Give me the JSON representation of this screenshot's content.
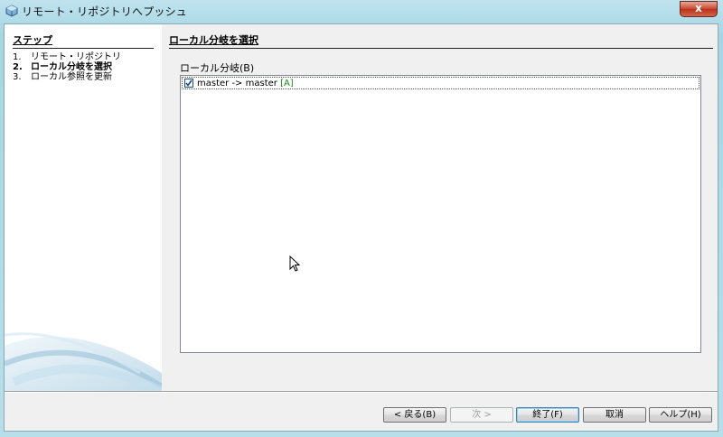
{
  "window": {
    "title": "リモート・リポジトリへプッシュ",
    "close_label": "x"
  },
  "steps": {
    "heading": "ステップ",
    "items": [
      {
        "num": "1.",
        "label": "リモート・リポジトリ",
        "active": false
      },
      {
        "num": "2.",
        "label": "ローカル分岐を選択",
        "active": true
      },
      {
        "num": "3.",
        "label": "ローカル参照を更新",
        "active": false
      }
    ]
  },
  "content": {
    "heading": "ローカル分岐を選択",
    "list_label": "ローカル分岐(B)",
    "branches": [
      {
        "checked": true,
        "text": "master -> master ",
        "tag": "[A]"
      }
    ]
  },
  "buttons": {
    "back": "< 戻る(B)",
    "next": "次 >",
    "finish": "終了(F)",
    "cancel": "取消",
    "help": "ヘルプ(H)"
  },
  "colors": {
    "frame": "#a6d6e4",
    "close": "#c7472e",
    "tag": "#1a8a1a"
  }
}
